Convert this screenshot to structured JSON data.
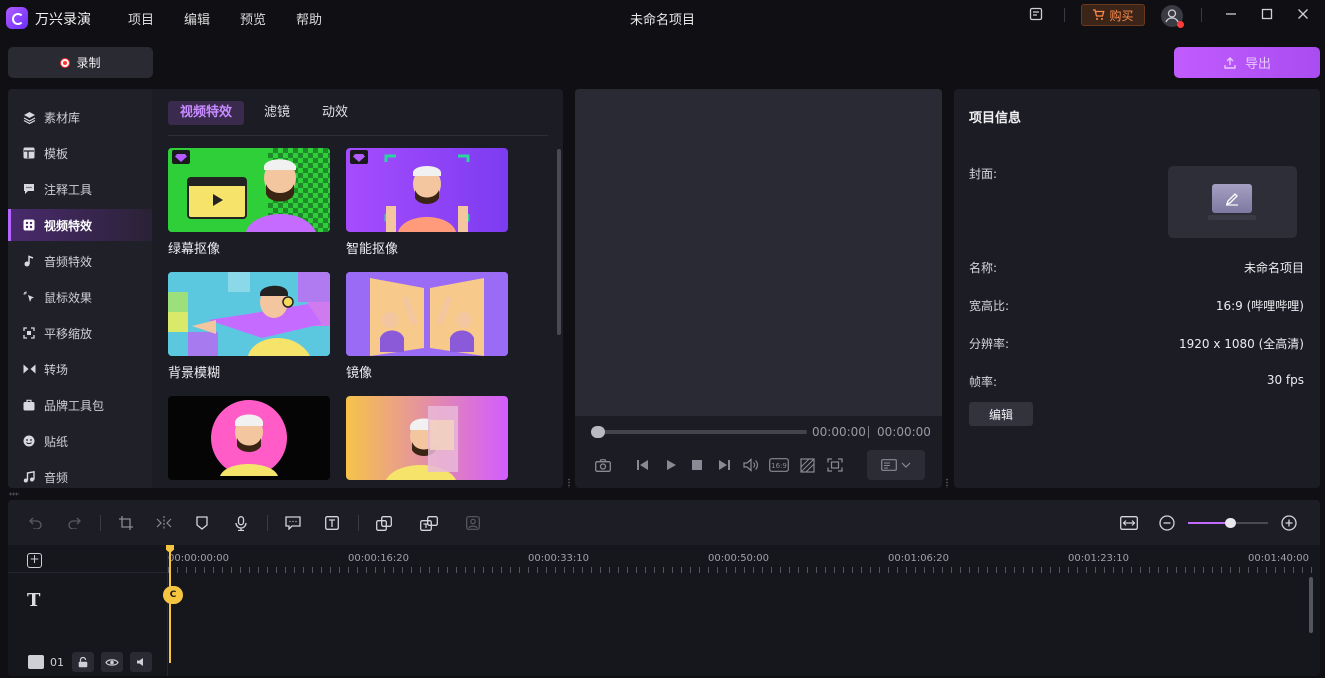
{
  "app": {
    "name": "万兴录演",
    "document_title": "未命名项目",
    "menu": [
      "项目",
      "编辑",
      "预览",
      "帮助"
    ],
    "buy_label": "购买"
  },
  "record": {
    "label": "录制"
  },
  "export": {
    "label": "导出"
  },
  "sidebar": {
    "items": [
      {
        "label": "素材库",
        "icon": "layers-icon"
      },
      {
        "label": "模板",
        "icon": "template-icon"
      },
      {
        "label": "注释工具",
        "icon": "annotation-icon"
      },
      {
        "label": "视频特效",
        "icon": "video-effects-icon",
        "active": true
      },
      {
        "label": "音频特效",
        "icon": "music-note-icon"
      },
      {
        "label": "鼠标效果",
        "icon": "cursor-click-icon"
      },
      {
        "label": "平移缩放",
        "icon": "pan-zoom-icon"
      },
      {
        "label": "转场",
        "icon": "transition-icon"
      },
      {
        "label": "品牌工具包",
        "icon": "brand-kit-icon"
      },
      {
        "label": "贴纸",
        "icon": "sticker-icon"
      },
      {
        "label": "音频",
        "icon": "audio-icon"
      }
    ]
  },
  "effects": {
    "tabs": [
      "视频特效",
      "滤镜",
      "动效"
    ],
    "items": [
      {
        "label": "绿幕抠像",
        "premium": true
      },
      {
        "label": "智能抠像",
        "premium": true
      },
      {
        "label": "背景模糊",
        "premium": false
      },
      {
        "label": "镜像",
        "premium": false
      },
      {
        "label": "",
        "premium": false
      },
      {
        "label": "",
        "premium": false
      }
    ]
  },
  "preview": {
    "current_time": "00:00:00",
    "total_time": "00:00:00",
    "ratio_badge": "16:9"
  },
  "project_info": {
    "title": "项目信息",
    "cover_label": "封面:",
    "rows": [
      {
        "label": "名称:",
        "value": "未命名项目"
      },
      {
        "label": "宽高比:",
        "value": "16:9 (哔哩哔哩)"
      },
      {
        "label": "分辨率:",
        "value": "1920 x 1080 (全高清)"
      },
      {
        "label": "帧率:",
        "value": "30 fps"
      }
    ],
    "edit_label": "编辑"
  },
  "timeline": {
    "ruler_labels": [
      "00:00:00:00",
      "00:00:16:20",
      "00:00:33:10",
      "00:00:50:00",
      "00:01:06:20",
      "00:01:23:10",
      "00:01:40:00"
    ],
    "track_number": "01",
    "playhead_tag": "C"
  },
  "colors": {
    "accent": "#b266ff",
    "export_gradient_start": "#c15cff",
    "record_red": "#ff3434",
    "buy_orange": "#ff8c4a",
    "playhead": "#f5c542"
  }
}
